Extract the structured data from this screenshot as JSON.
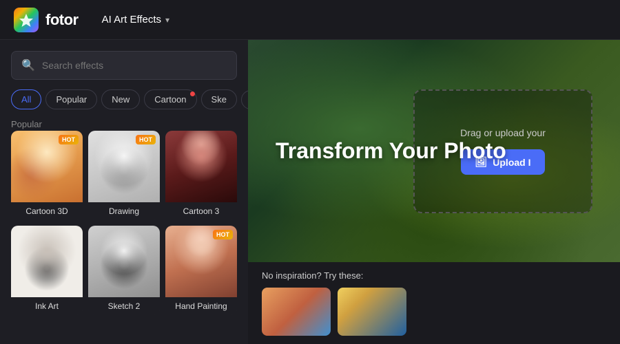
{
  "header": {
    "logo_text": "fotor",
    "nav_label": "AI Art Effects",
    "nav_arrow": "▾"
  },
  "sidebar": {
    "search_placeholder": "Search effects",
    "filter_tabs": [
      {
        "id": "all",
        "label": "All",
        "active": true,
        "dot": false
      },
      {
        "id": "popular",
        "label": "Popular",
        "active": false,
        "dot": false
      },
      {
        "id": "new",
        "label": "New",
        "active": false,
        "dot": false
      },
      {
        "id": "cartoon",
        "label": "Cartoon",
        "active": false,
        "dot": true
      },
      {
        "id": "sketch",
        "label": "Ske",
        "active": false,
        "dot": false
      }
    ],
    "scroll_arrow": "›",
    "popular_label": "Popular",
    "effects_popular": [
      {
        "id": "cartoon3d",
        "label": "Cartoon 3D",
        "hot": true
      },
      {
        "id": "drawing",
        "label": "Drawing",
        "hot": true
      },
      {
        "id": "cartoon3",
        "label": "Cartoon 3",
        "hot": false
      }
    ],
    "effects_row2": [
      {
        "id": "inkart",
        "label": "Ink Art",
        "hot": false
      },
      {
        "id": "sketch2",
        "label": "Sketch 2",
        "hot": false
      },
      {
        "id": "handpainting",
        "label": "Hand Painting",
        "hot": true
      }
    ]
  },
  "hero": {
    "title": "Transform Your Photo",
    "upload_subtitle": "Drag or upload your",
    "upload_btn_label": "Upload I",
    "upload_icon": "🖼"
  },
  "inspiration": {
    "label": "No inspiration? Try these:"
  }
}
